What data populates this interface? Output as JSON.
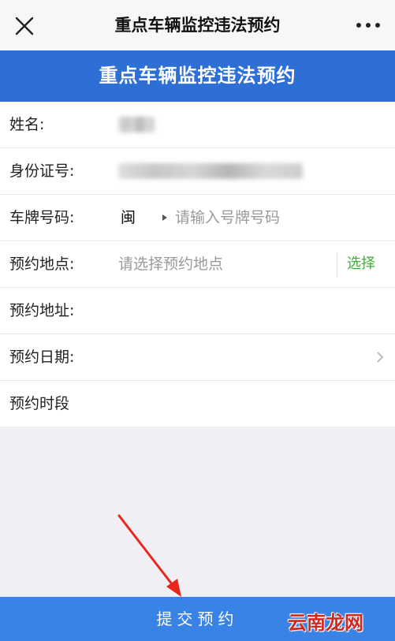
{
  "topbar": {
    "title": "重点车辆监控违法预约",
    "close_icon": "close-icon",
    "more_icon": "more-icon"
  },
  "banner": {
    "title": "重点车辆监控违法预约",
    "color": "#2e6fd6"
  },
  "form": {
    "name_label": "姓名:",
    "id_label": "身份证号:",
    "plate_label": "车牌号码:",
    "plate_province": "闽",
    "plate_placeholder": "请输入号牌号码",
    "location_label": "预约地点:",
    "location_placeholder": "请选择预约地点",
    "choose_label": "选择",
    "address_label": "预约地址:",
    "date_label": "预约日期:",
    "time_label": "预约时段"
  },
  "submit": {
    "label": "提交预约",
    "color": "#3a83e6"
  },
  "watermark": {
    "text": "云南龙网"
  },
  "colors": {
    "accent_green": "#3cb034",
    "arrow_red": "#e8261c"
  }
}
